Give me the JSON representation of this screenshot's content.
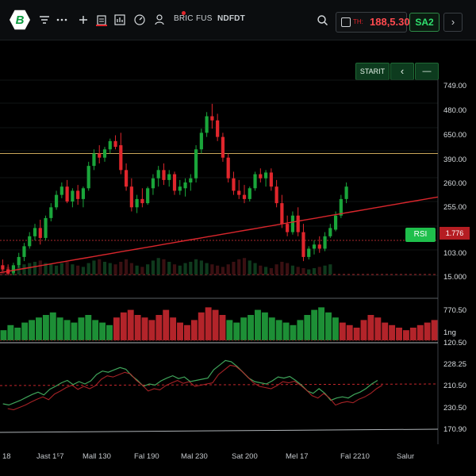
{
  "toolbar": {
    "logo_letter": "B",
    "tools": [
      "BRIC",
      "FUS",
      "NDFDT"
    ],
    "ticker_symbol": "TH:",
    "ticker_price": "188,5.30",
    "account_label": "SA2",
    "nav_next": "›"
  },
  "chart_controls": {
    "start_label": "STARIT",
    "back_label": "‹",
    "minimize_label": "—"
  },
  "price_axis": [
    "749.00",
    "480.00",
    "650.00",
    "390.00",
    "260.00",
    "255.00",
    "103.00",
    "15.000"
  ],
  "rsi_label": "RSI",
  "last_price": "1.776",
  "volume_axis": [
    "770.50",
    "1ng"
  ],
  "osc_axis": [
    "120.50",
    "228.25",
    "210.50",
    "230.50",
    "170.90"
  ],
  "time_axis": [
    "18",
    "Jast 1⁵7",
    "Mall 130",
    "Fal 190",
    "Mal 230",
    "Sat 200",
    "Mel 17",
    "Fal 2210",
    "Salur"
  ],
  "colors": {
    "up": "#1aa53a",
    "down": "#e0262c",
    "ma": "#d9262c",
    "resistance": "#c9a75a",
    "background": "#000000"
  },
  "chart_data": {
    "type": "candlestick",
    "candles": [
      {
        "o": 15,
        "h": 22,
        "l": 8,
        "c": 10
      },
      {
        "o": 10,
        "h": 16,
        "l": 3,
        "c": 5
      },
      {
        "o": 6,
        "h": 18,
        "l": 3,
        "c": 15
      },
      {
        "o": 15,
        "h": 30,
        "l": 12,
        "c": 25
      },
      {
        "o": 25,
        "h": 42,
        "l": 20,
        "c": 38
      },
      {
        "o": 38,
        "h": 55,
        "l": 35,
        "c": 50
      },
      {
        "o": 50,
        "h": 65,
        "l": 45,
        "c": 60
      },
      {
        "o": 60,
        "h": 70,
        "l": 40,
        "c": 48
      },
      {
        "o": 48,
        "h": 75,
        "l": 45,
        "c": 72
      },
      {
        "o": 72,
        "h": 90,
        "l": 68,
        "c": 85
      },
      {
        "o": 85,
        "h": 105,
        "l": 82,
        "c": 100
      },
      {
        "o": 100,
        "h": 115,
        "l": 96,
        "c": 110
      },
      {
        "o": 110,
        "h": 118,
        "l": 90,
        "c": 92
      },
      {
        "o": 92,
        "h": 108,
        "l": 85,
        "c": 105
      },
      {
        "o": 105,
        "h": 112,
        "l": 88,
        "c": 95
      },
      {
        "o": 95,
        "h": 110,
        "l": 85,
        "c": 108
      },
      {
        "o": 108,
        "h": 140,
        "l": 105,
        "c": 135
      },
      {
        "o": 135,
        "h": 155,
        "l": 130,
        "c": 150
      },
      {
        "o": 150,
        "h": 160,
        "l": 138,
        "c": 145
      },
      {
        "o": 145,
        "h": 158,
        "l": 140,
        "c": 155
      },
      {
        "o": 155,
        "h": 168,
        "l": 150,
        "c": 165
      },
      {
        "o": 165,
        "h": 172,
        "l": 155,
        "c": 158
      },
      {
        "o": 160,
        "h": 175,
        "l": 125,
        "c": 130
      },
      {
        "o": 130,
        "h": 138,
        "l": 105,
        "c": 110
      },
      {
        "o": 110,
        "h": 120,
        "l": 80,
        "c": 85
      },
      {
        "o": 85,
        "h": 100,
        "l": 78,
        "c": 95
      },
      {
        "o": 95,
        "h": 108,
        "l": 85,
        "c": 90
      },
      {
        "o": 90,
        "h": 110,
        "l": 88,
        "c": 108
      },
      {
        "o": 108,
        "h": 125,
        "l": 100,
        "c": 120
      },
      {
        "o": 120,
        "h": 135,
        "l": 110,
        "c": 130
      },
      {
        "o": 130,
        "h": 138,
        "l": 112,
        "c": 118
      },
      {
        "o": 118,
        "h": 130,
        "l": 110,
        "c": 125
      },
      {
        "o": 125,
        "h": 128,
        "l": 100,
        "c": 105
      },
      {
        "o": 105,
        "h": 118,
        "l": 100,
        "c": 110
      },
      {
        "o": 108,
        "h": 120,
        "l": 98,
        "c": 115
      },
      {
        "o": 115,
        "h": 125,
        "l": 105,
        "c": 120
      },
      {
        "o": 120,
        "h": 160,
        "l": 115,
        "c": 155
      },
      {
        "o": 155,
        "h": 180,
        "l": 150,
        "c": 175
      },
      {
        "o": 175,
        "h": 200,
        "l": 170,
        "c": 195
      },
      {
        "o": 195,
        "h": 210,
        "l": 180,
        "c": 190
      },
      {
        "o": 190,
        "h": 198,
        "l": 165,
        "c": 170
      },
      {
        "o": 170,
        "h": 175,
        "l": 140,
        "c": 145
      },
      {
        "o": 145,
        "h": 150,
        "l": 115,
        "c": 120
      },
      {
        "o": 120,
        "h": 128,
        "l": 100,
        "c": 105
      },
      {
        "o": 105,
        "h": 118,
        "l": 95,
        "c": 100
      },
      {
        "o": 100,
        "h": 112,
        "l": 90,
        "c": 95
      },
      {
        "o": 95,
        "h": 110,
        "l": 92,
        "c": 108
      },
      {
        "o": 108,
        "h": 128,
        "l": 105,
        "c": 125
      },
      {
        "o": 125,
        "h": 132,
        "l": 115,
        "c": 120
      },
      {
        "o": 120,
        "h": 130,
        "l": 110,
        "c": 127
      },
      {
        "o": 127,
        "h": 132,
        "l": 105,
        "c": 110
      },
      {
        "o": 110,
        "h": 118,
        "l": 85,
        "c": 90
      },
      {
        "o": 90,
        "h": 100,
        "l": 60,
        "c": 65
      },
      {
        "o": 65,
        "h": 75,
        "l": 50,
        "c": 55
      },
      {
        "o": 55,
        "h": 80,
        "l": 52,
        "c": 75
      },
      {
        "o": 75,
        "h": 85,
        "l": 50,
        "c": 55
      },
      {
        "o": 55,
        "h": 65,
        "l": 20,
        "c": 25
      },
      {
        "o": 25,
        "h": 38,
        "l": 22,
        "c": 35
      },
      {
        "o": 35,
        "h": 45,
        "l": 28,
        "c": 40
      },
      {
        "o": 40,
        "h": 50,
        "l": 30,
        "c": 35
      },
      {
        "o": 35,
        "h": 55,
        "l": 32,
        "c": 50
      },
      {
        "o": 50,
        "h": 65,
        "l": 48,
        "c": 60
      },
      {
        "o": 58,
        "h": 80,
        "l": 56,
        "c": 75
      },
      {
        "o": 75,
        "h": 100,
        "l": 72,
        "c": 95
      },
      {
        "o": 95,
        "h": 115,
        "l": 90,
        "c": 110
      }
    ],
    "moving_average": [
      8,
      10,
      12,
      14,
      16,
      18,
      20,
      22,
      24,
      26,
      28,
      30,
      32,
      34,
      36,
      38,
      40,
      42,
      44,
      46,
      48,
      50,
      52,
      54,
      56,
      58,
      60,
      62,
      64,
      66,
      68,
      70,
      72,
      74,
      76,
      78,
      80,
      82,
      84,
      86,
      88,
      90,
      92,
      94,
      96,
      98,
      100,
      102,
      104,
      106,
      108,
      110,
      112,
      114,
      116,
      118,
      120,
      122,
      124,
      126,
      128,
      130
    ],
    "resistance_level": 150,
    "support_level": 45,
    "volume": [
      4,
      6,
      5,
      7,
      8,
      9,
      10,
      11,
      9,
      8,
      7,
      9,
      10,
      8,
      7,
      6,
      9,
      11,
      12,
      10,
      9,
      8,
      10,
      12,
      9,
      7,
      6,
      8,
      11,
      13,
      12,
      10,
      8,
      7,
      9,
      10,
      12,
      11,
      9,
      8,
      7,
      6,
      8,
      10,
      12,
      13,
      11,
      9,
      7,
      6,
      5,
      8,
      10,
      9,
      7,
      6,
      5,
      4,
      5,
      6,
      7,
      8
    ]
  }
}
